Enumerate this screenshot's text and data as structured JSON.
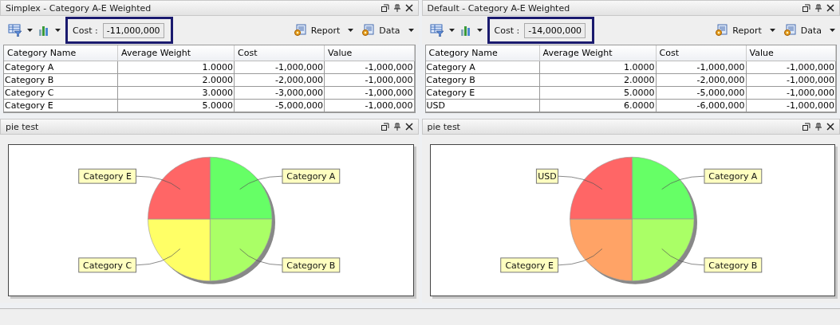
{
  "panels": [
    {
      "title": "Simplex - Category A-E Weighted",
      "cost_label": "Cost :",
      "cost_value": "-11,000,000",
      "report": "Report",
      "data": "Data",
      "table": {
        "columns": [
          "Category Name",
          "Average Weight",
          "Cost",
          "Value"
        ],
        "rows": [
          [
            "Category A",
            "1.0000",
            "-1,000,000",
            "-1,000,000"
          ],
          [
            "Category B",
            "2.0000",
            "-2,000,000",
            "-1,000,000"
          ],
          [
            "Category C",
            "3.0000",
            "-3,000,000",
            "-1,000,000"
          ],
          [
            "Category E",
            "5.0000",
            "-5,000,000",
            "-1,000,000"
          ]
        ]
      },
      "chart_panel": {
        "title": "pie test",
        "chart_data": {
          "type": "pie",
          "categories": [
            "Category A",
            "Category B",
            "Category C",
            "Category E"
          ],
          "colors": [
            "#66ff66",
            "#aaff66",
            "#ffff66",
            "#ff6666"
          ],
          "values": [
            25,
            25,
            25,
            25
          ]
        }
      }
    },
    {
      "title": "Default - Category A-E Weighted",
      "cost_label": "Cost :",
      "cost_value": "-14,000,000",
      "report": "Report",
      "data": "Data",
      "table": {
        "columns": [
          "Category Name",
          "Average Weight",
          "Cost",
          "Value"
        ],
        "rows": [
          [
            "Category A",
            "1.0000",
            "-1,000,000",
            "-1,000,000"
          ],
          [
            "Category B",
            "2.0000",
            "-2,000,000",
            "-1,000,000"
          ],
          [
            "Category E",
            "5.0000",
            "-5,000,000",
            "-1,000,000"
          ],
          [
            "USD",
            "6.0000",
            "-6,000,000",
            "-1,000,000"
          ]
        ]
      },
      "chart_panel": {
        "title": "pie test",
        "chart_data": {
          "type": "pie",
          "categories": [
            "Category A",
            "Category B",
            "Category E",
            "USD"
          ],
          "colors": [
            "#66ff66",
            "#aaff66",
            "#ffa366",
            "#ff6666"
          ],
          "values": [
            25,
            25,
            25,
            25
          ]
        }
      }
    }
  ]
}
